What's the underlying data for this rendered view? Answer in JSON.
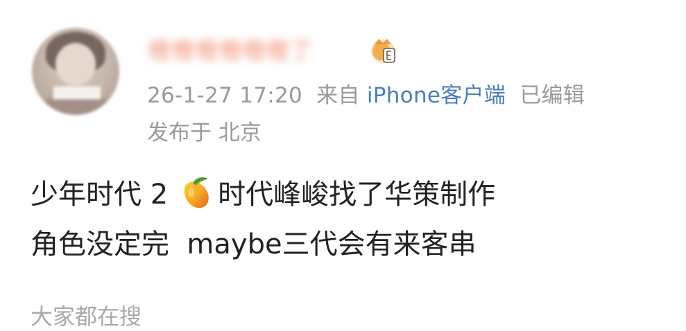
{
  "post": {
    "username": "橙橙橙橙橙橙了",
    "timestamp": "26-1-27 17:20",
    "source_prefix": "来自",
    "source_client": "iPhone客户端",
    "edited": "已编辑",
    "location": "发布于 北京",
    "content_line1_before_emoji": "少年时代 2",
    "content_line1_after_emoji": "时代峰峻找了华策制作",
    "content_line2": "角色没定完  maybe三代会有来客串",
    "emoji": "mango-icon",
    "search_section_label": "大家都在搜"
  },
  "colors": {
    "meta_text": "#9a9a9a",
    "link": "#4a7fb5",
    "body_text": "#222222",
    "vip_gold": "#f0a43a"
  }
}
